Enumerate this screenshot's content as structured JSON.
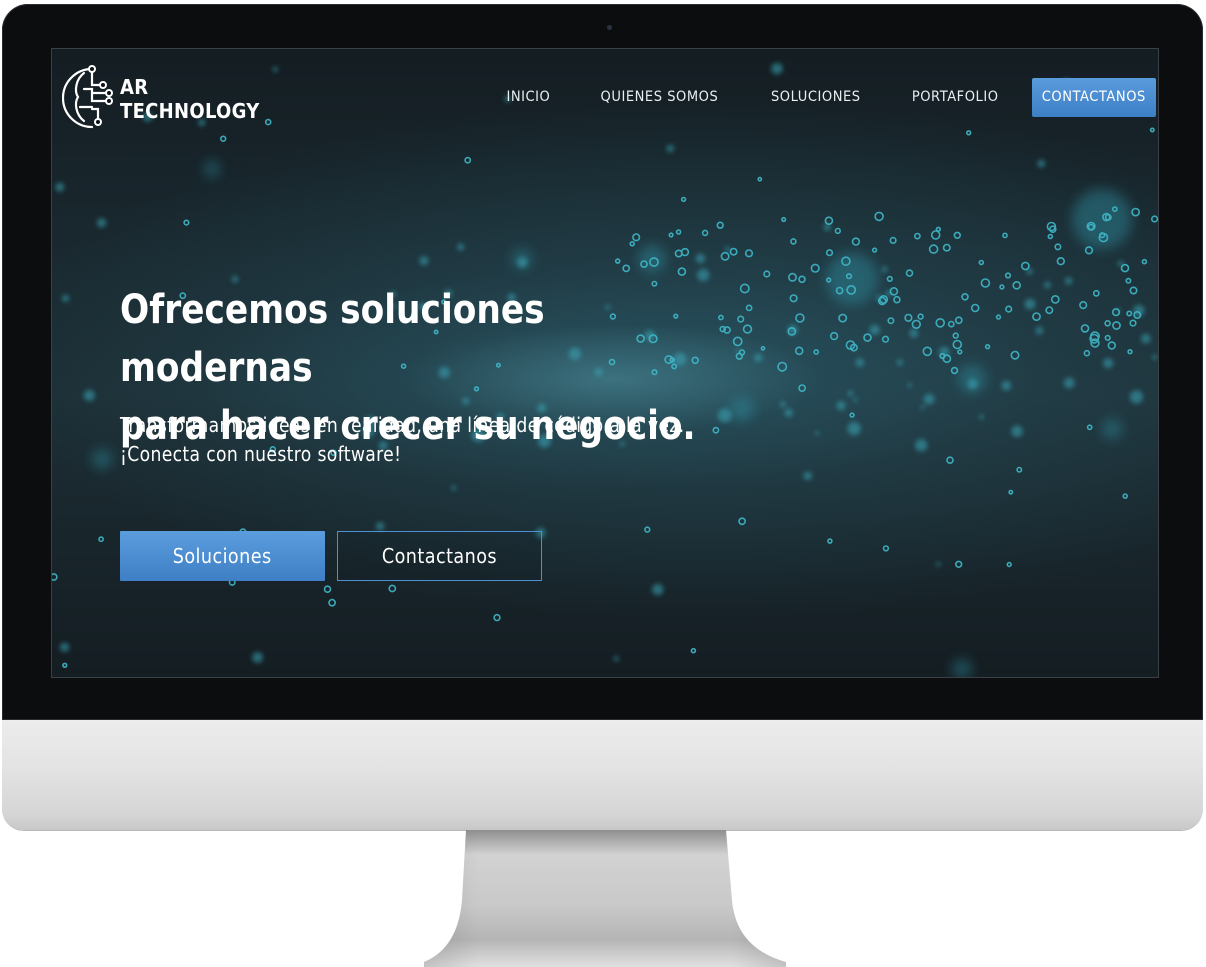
{
  "logo": {
    "line1": "AR",
    "line2": "TECHNOLOGY",
    "icon": "circuit-brain-icon"
  },
  "nav": {
    "items": [
      {
        "label": "INICIO"
      },
      {
        "label": "QUIENES SOMOS"
      },
      {
        "label": "SOLUCIONES"
      },
      {
        "label": "PORTAFOLIO"
      }
    ],
    "cta_label": "CONTACTANOS"
  },
  "hero": {
    "title_line1": "Ofrecemos soluciones modernas",
    "title_line2": "para hacer crecer su negocio.",
    "subtitle_line1": "Transformamos ideas en realidad, una línea de código a la vez.",
    "subtitle_line2": "¡Conecta con nuestro software!",
    "primary_button": "Soluciones",
    "secondary_button": "Contactanos"
  },
  "colors": {
    "accent_blue": "#4a8bd0",
    "screen_bg": "#1a2a31",
    "particle": "#3fb8c8"
  }
}
